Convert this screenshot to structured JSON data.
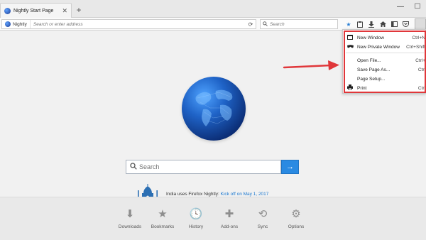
{
  "tab": {
    "title": "Nightly Start Page",
    "close": "✕",
    "new_tab": "+"
  },
  "window_controls": {
    "minimize": "—",
    "maximize": "☐"
  },
  "urlbar": {
    "identity": "Nightly",
    "placeholder": "Search or enter address",
    "reload": "⟳"
  },
  "searchbar": {
    "placeholder": "Search"
  },
  "toolbar": {
    "icons": [
      "bookmark-star-icon",
      "reading-list-icon",
      "downloads-icon",
      "home-icon",
      "sidebar-icon",
      "pocket-icon"
    ]
  },
  "content": {
    "search_placeholder": "Search",
    "search_go": "→",
    "snippet_text": "India uses Firefox Nightly: ",
    "snippet_link": "Kick off on May 1, 2017"
  },
  "launcher": [
    {
      "label": "Downloads",
      "icon": "⬇"
    },
    {
      "label": "Bookmarks",
      "icon": "★"
    },
    {
      "label": "History",
      "icon": "🕓"
    },
    {
      "label": "Add-ons",
      "icon": "✚"
    },
    {
      "label": "Sync",
      "icon": "⟲"
    },
    {
      "label": "Options",
      "icon": "⚙"
    }
  ],
  "menu": {
    "items": [
      {
        "label": "New Window",
        "shortcut": "Ctrl+N",
        "icon": "new-window-icon"
      },
      {
        "label": "New Private Window",
        "shortcut": "Ctrl+Shift",
        "icon": "private-mask-icon"
      },
      {
        "label": "Open File...",
        "shortcut": "Ctrl+"
      },
      {
        "label": "Save Page As...",
        "shortcut": "Ctrl"
      },
      {
        "label": "Page Setup...",
        "shortcut": ""
      },
      {
        "label": "Print",
        "shortcut": "Ctrl",
        "icon": "print-icon"
      }
    ]
  },
  "colors": {
    "accent": "#2a8ae2",
    "highlight": "#e0373a",
    "link": "#1a77cf"
  }
}
